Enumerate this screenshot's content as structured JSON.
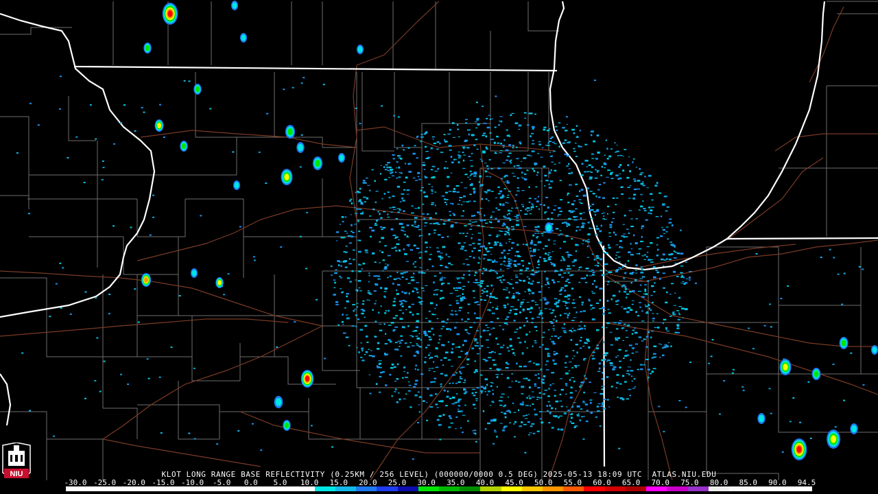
{
  "title": "KLOT LONG RANGE BASE REFLECTIVITY (0.25KM / 256 LEVEL) (000000/0000 0.5 DEG) 2025-05-13 18:09 UTC  ATLAS.NIU.EDU",
  "logo": {
    "text": "NIU",
    "icon": "niu-tower-logo",
    "color": "#c8102e"
  },
  "scale": {
    "ticks": [
      "-30.0",
      "-25.0",
      "-20.0",
      "-15.0",
      "-10.0",
      "-5.0",
      "0.0",
      "5.0",
      "10.0",
      "15.0",
      "20.0",
      "25.0",
      "30.0",
      "35.0",
      "40.0",
      "45.0",
      "50.0",
      "55.0",
      "60.0",
      "65.0",
      "70.0",
      "75.0",
      "80.0",
      "85.0",
      "90.0",
      "94.5"
    ],
    "colors": [
      "#ffffff",
      "#ffffff",
      "#ffffff",
      "#ffffff",
      "#ffffff",
      "#ffffff",
      "#ffffff",
      "#ffffff",
      "#ffffff",
      "#ffffff",
      "#ffffff",
      "#ffffff",
      "#00e5e5",
      "#12b8e8",
      "#1e78f0",
      "#1e3cf0",
      "#0c0cb0",
      "#00e600",
      "#00b800",
      "#008c00",
      "#b4d200",
      "#ffff00",
      "#ffc800",
      "#ff9600",
      "#ff5a00",
      "#ff0000",
      "#d20000",
      "#aa0000",
      "#ff00ff",
      "#c800c8",
      "#9632c8",
      "#eeeeee",
      "#f8f8f8",
      "#ffffff",
      "#ffffff",
      "#ffffff"
    ]
  },
  "map_colors": {
    "background": "#000000",
    "state_borders": "#ffffff",
    "county_lines": "#6e6e6e",
    "highways": "#7a3b26",
    "radar_center": "#000000"
  },
  "radar": {
    "site": "KLOT",
    "clutter_color": "#12b8e8",
    "storm_colors": [
      "#1e78f0",
      "#00e5e5",
      "#00e600",
      "#ffff00",
      "#ff9600",
      "#ff0000"
    ]
  }
}
